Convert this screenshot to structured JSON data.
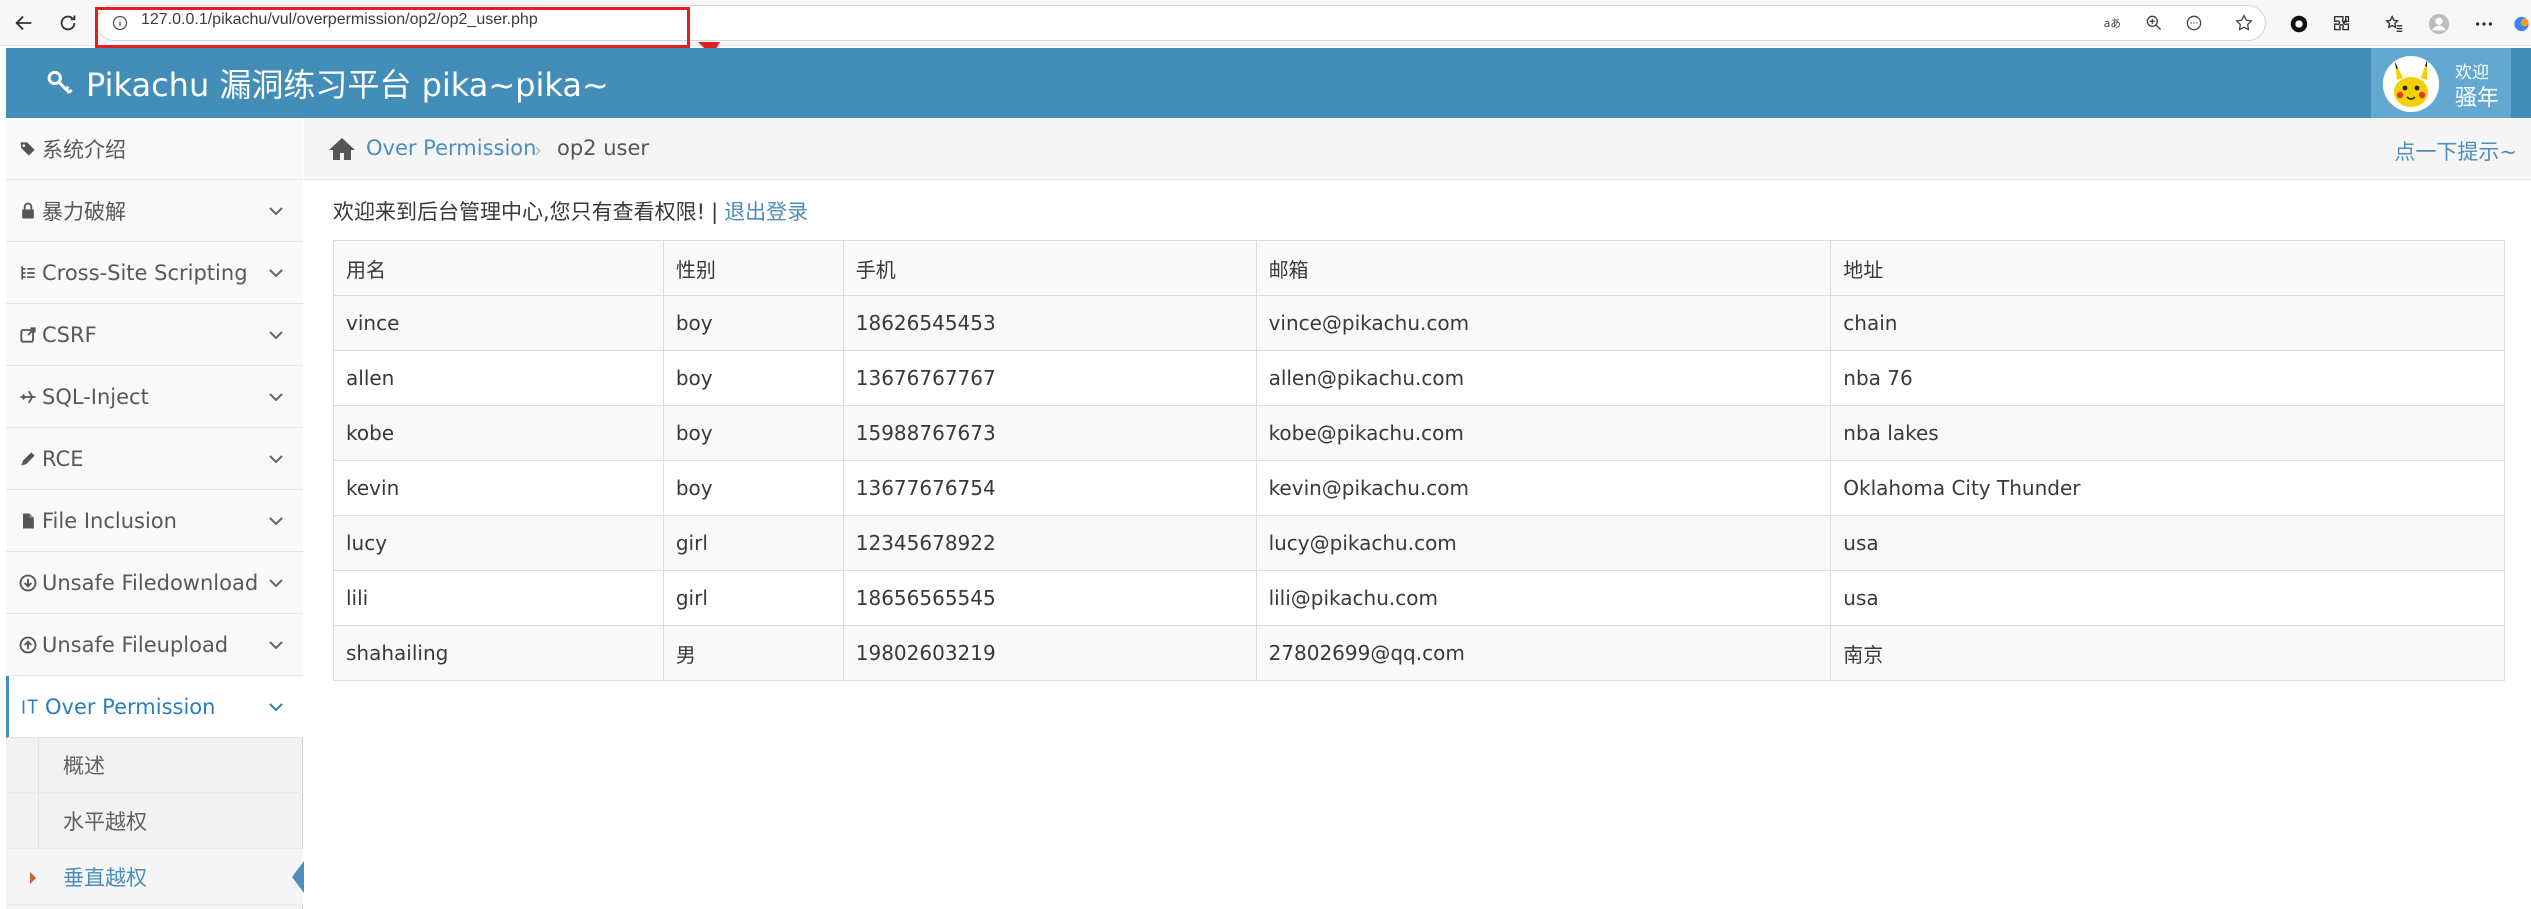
{
  "browser": {
    "url": "127.0.0.1/pikachu/vul/overpermission/op2/op2_user.php"
  },
  "header": {
    "brand": "Pikachu 漏洞练习平台 pika~pika~",
    "welcome": "欢迎",
    "username": "骚年"
  },
  "sidebar": {
    "items": [
      {
        "label": "系统介绍",
        "icon": "tags-icon"
      },
      {
        "label": "暴力破解",
        "icon": "lock-icon"
      },
      {
        "label": "Cross-Site Scripting",
        "icon": "list-icon"
      },
      {
        "label": "CSRF",
        "icon": "share-icon"
      },
      {
        "label": "SQL-Inject",
        "icon": "plane-icon"
      },
      {
        "label": "RCE",
        "icon": "pencil-icon"
      },
      {
        "label": "File Inclusion",
        "icon": "file-icon"
      },
      {
        "label": "Unsafe Filedownload",
        "icon": "download-icon"
      },
      {
        "label": "Unsafe Fileupload",
        "icon": "upload-icon"
      },
      {
        "label": "Over Permission",
        "icon": "text-cursor-icon"
      }
    ],
    "submenu": [
      {
        "label": "概述"
      },
      {
        "label": "水平越权"
      },
      {
        "label": "垂直越权"
      }
    ]
  },
  "breadcrumb": {
    "link": "Over Permission",
    "separator": "›",
    "current": "op2 user",
    "hint": "点一下提示~"
  },
  "main": {
    "welcome_text": "欢迎来到后台管理中心,您只有查看权限!",
    "separator": "|",
    "logout": "退出登录"
  },
  "table": {
    "headers": [
      "用名",
      "性别",
      "手机",
      "邮箱",
      "地址"
    ],
    "rows": [
      [
        "vince",
        "boy",
        "18626545453",
        "vince@pikachu.com",
        "chain"
      ],
      [
        "allen",
        "boy",
        "13676767767",
        "allen@pikachu.com",
        "nba 76"
      ],
      [
        "kobe",
        "boy",
        "15988767673",
        "kobe@pikachu.com",
        "nba lakes"
      ],
      [
        "kevin",
        "boy",
        "13677676754",
        "kevin@pikachu.com",
        "Oklahoma City Thunder"
      ],
      [
        "lucy",
        "girl",
        "12345678922",
        "lucy@pikachu.com",
        "usa"
      ],
      [
        "lili",
        "girl",
        "18656565545",
        "lili@pikachu.com",
        "usa"
      ],
      [
        "shahailing",
        "男",
        "19802603219",
        "27802699@qq.com",
        "南京"
      ]
    ]
  },
  "colors": {
    "header_bg": "#438eb9",
    "link": "#4c8fbd",
    "highlight": "#e02020"
  }
}
